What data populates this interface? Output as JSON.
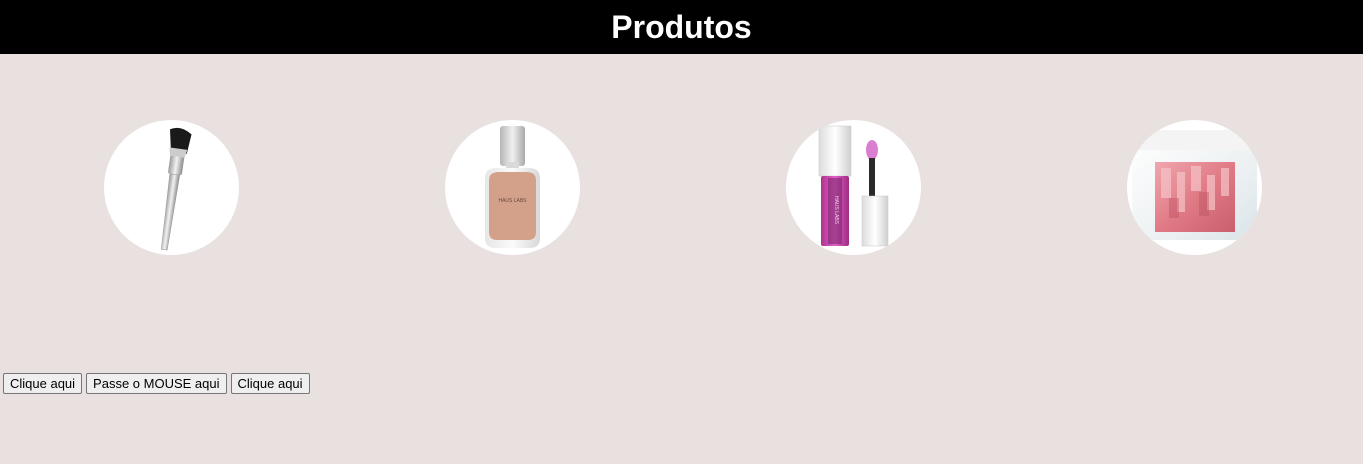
{
  "header": {
    "title": "Produtos"
  },
  "products": [
    {
      "icon": "makeup-brush-icon"
    },
    {
      "icon": "foundation-bottle-icon",
      "brand": "HAUS LABS"
    },
    {
      "icon": "lip-gloss-icon",
      "brand": "HAUS LABS"
    },
    {
      "icon": "blush-compact-icon"
    }
  ],
  "buttons": {
    "click1": "Clique aqui",
    "hover": "Passe o MOUSE aqui",
    "click2": "Clique aqui"
  },
  "colors": {
    "background": "#e8e1e0",
    "header_bg": "#000000",
    "header_text": "#ffffff"
  }
}
